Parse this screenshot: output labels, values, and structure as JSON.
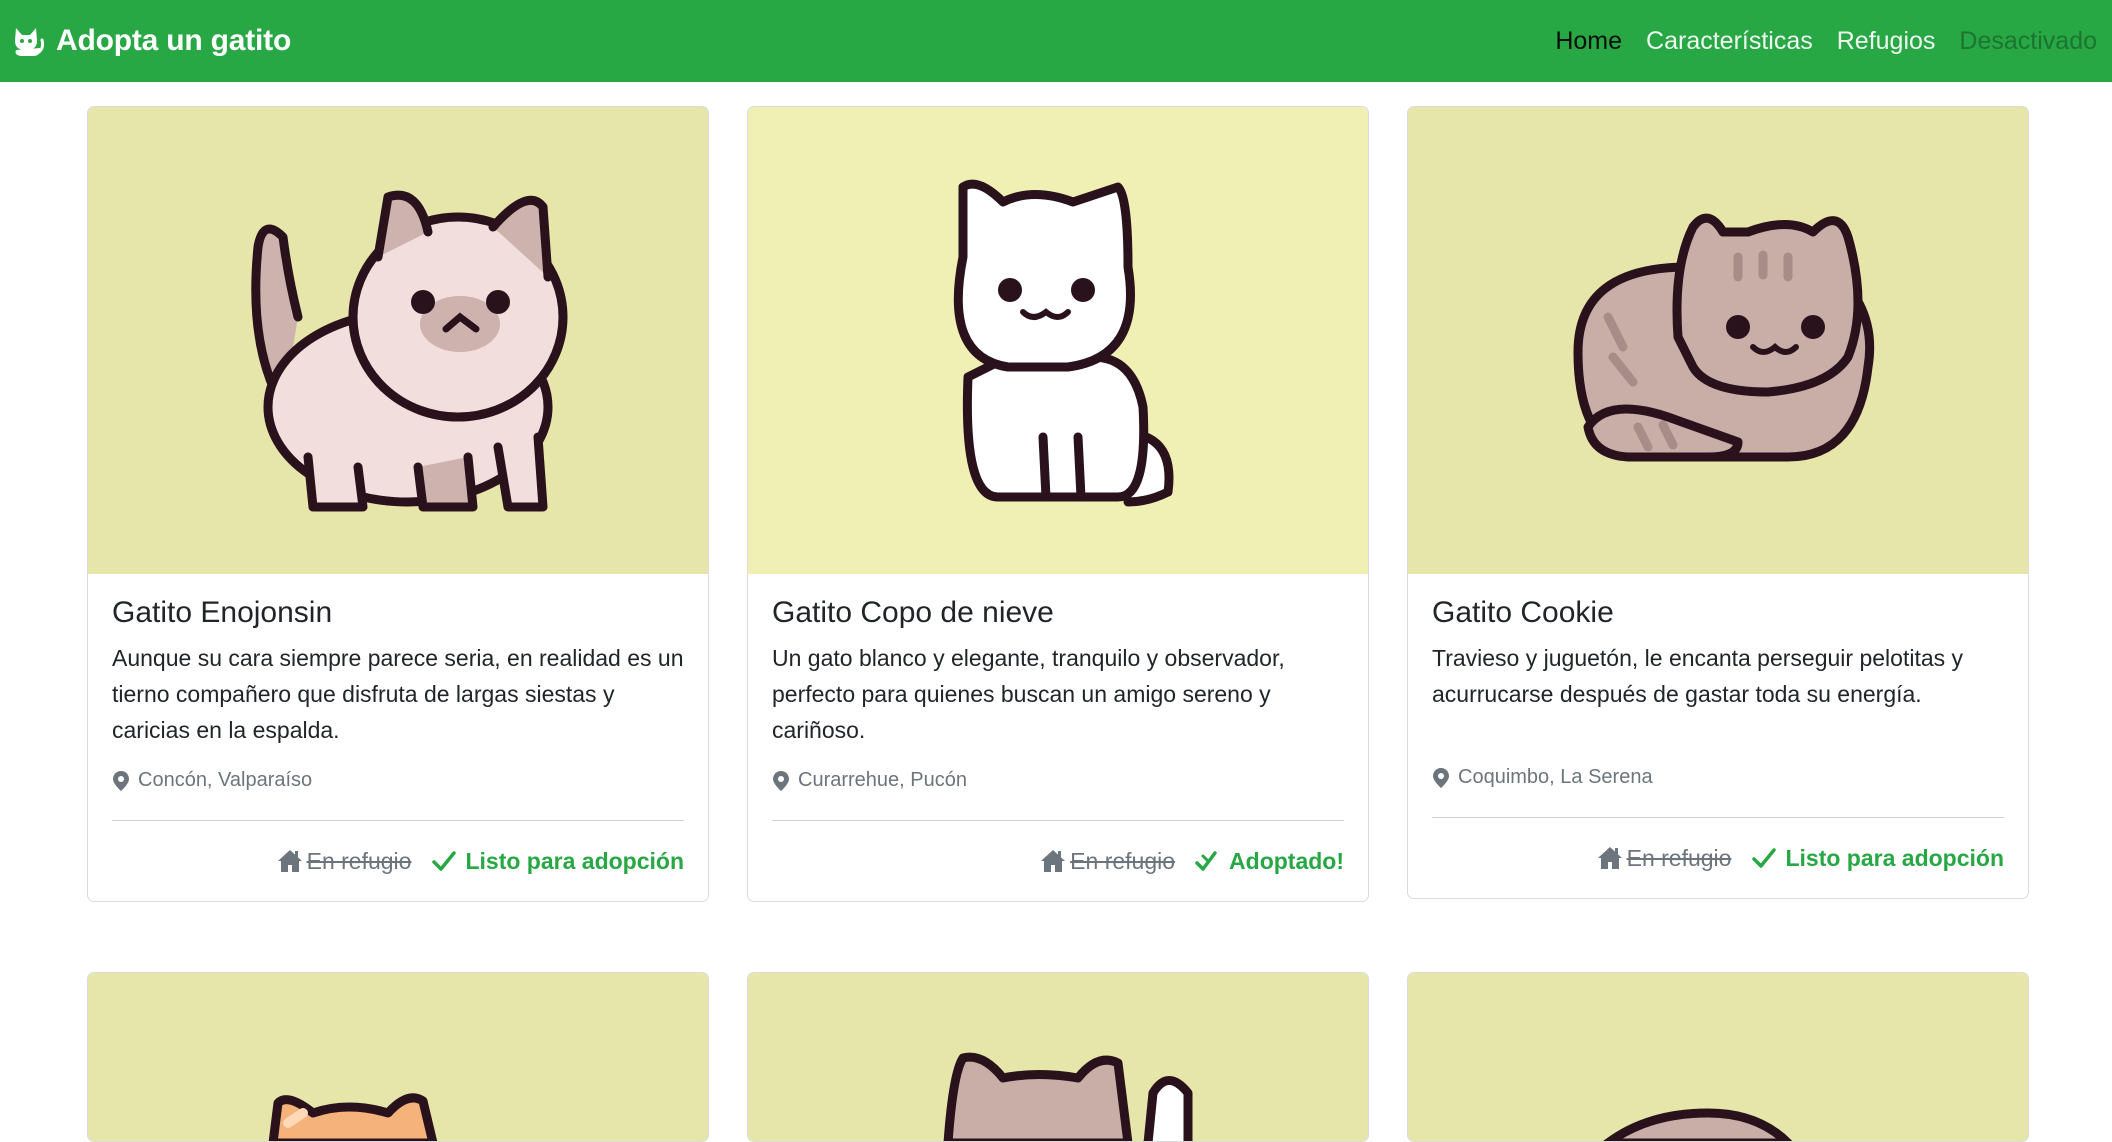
{
  "navbar": {
    "brand": "Adopta un gatito",
    "brand_icon": "cat-icon",
    "links": [
      {
        "label": "Home",
        "state": "active"
      },
      {
        "label": "Características",
        "state": "normal"
      },
      {
        "label": "Refugios",
        "state": "normal"
      },
      {
        "label": "Desactivado",
        "state": "disabled"
      }
    ]
  },
  "colors": {
    "primary": "#28a745",
    "muted": "#6c757d",
    "card_image_bg": "#e6e6aa"
  },
  "cards": [
    {
      "title": "Gatito Enojonsin",
      "description": "Aunque su cara siempre parece seria, en realidad es un tierno compañero que disfruta de largas siestas y caricias en la espalda.",
      "location": "Concón, Valparaíso",
      "status_off": "En refugio",
      "status_on": "Listo para adopción",
      "status_icon": "check-icon"
    },
    {
      "title": "Gatito Copo de nieve",
      "description": "Un gato blanco y elegante, tranquilo y observador, perfecto para quienes buscan un amigo sereno y cariñoso.",
      "location": "Curarrehue, Pucón",
      "status_off": "En refugio",
      "status_on": "Adoptado!",
      "status_icon": "double-check-icon"
    },
    {
      "title": "Gatito Cookie",
      "description": "Travieso y juguetón, le encanta perseguir pelotitas y acurrucarse después de gastar toda su energía.",
      "location": "Coquimbo, La Serena",
      "status_off": "En refugio",
      "status_on": "Listo para adopción",
      "status_icon": "check-icon"
    }
  ]
}
